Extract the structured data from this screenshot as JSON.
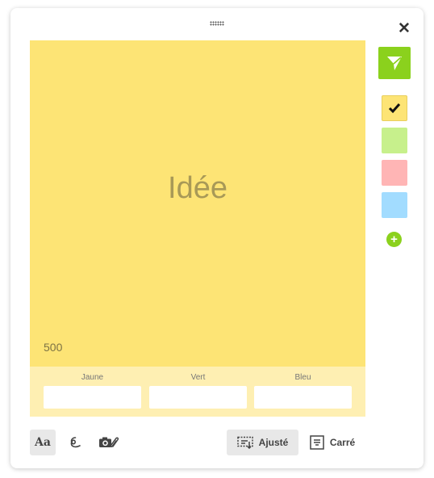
{
  "note": {
    "text": "Idée",
    "char_count": "500",
    "background_color": "#fde475"
  },
  "fields": [
    {
      "label": "Jaune",
      "value": ""
    },
    {
      "label": "Vert",
      "value": ""
    },
    {
      "label": "Bleu",
      "value": ""
    }
  ],
  "colors": {
    "accent": "#8bd11d",
    "swatches": [
      {
        "name": "yellow",
        "color": "#fde475",
        "selected": true
      },
      {
        "name": "green",
        "color": "#c7f08c",
        "selected": false
      },
      {
        "name": "pink",
        "color": "#ffb5b5",
        "selected": false
      },
      {
        "name": "blue",
        "color": "#a2dcff",
        "selected": false
      }
    ]
  },
  "toolbar": {
    "text_format_icon": "Aa",
    "draw_icon": "scribble-icon",
    "attach_icon": "camera-paperclip-icon",
    "fit_label": "Ajusté",
    "square_label": "Carré"
  },
  "icons": {
    "close": "close-icon",
    "send": "send-icon",
    "drag": "drag-handle-icon",
    "add": "plus-icon"
  }
}
